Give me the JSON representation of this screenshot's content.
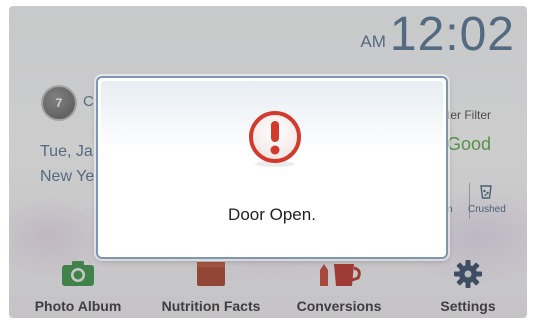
{
  "clock": {
    "ampm": "AM",
    "time": "12:02"
  },
  "calendar": {
    "icon_text": "7",
    "label": "C",
    "date": "Tue, Ja",
    "event": "New Ye"
  },
  "water_filter": {
    "label": "ter Filter",
    "status": "Good",
    "ice_left_label": "n",
    "ice_crushed_label": "Crushed"
  },
  "dock": [
    {
      "label": "Photo Album",
      "icon": "camera-icon"
    },
    {
      "label": "Nutrition Facts",
      "icon": "food-box-icon"
    },
    {
      "label": "Conversions",
      "icon": "measuring-cup-icon"
    },
    {
      "label": "Settings",
      "icon": "gear-icon"
    }
  ],
  "modal": {
    "icon": "exclamation-icon",
    "message": "Door Open."
  },
  "colors": {
    "accent_blue": "#4a6988",
    "status_good": "#4f9e3a",
    "alert_red": "#d23a2e",
    "modal_border": "#7e95b3"
  }
}
